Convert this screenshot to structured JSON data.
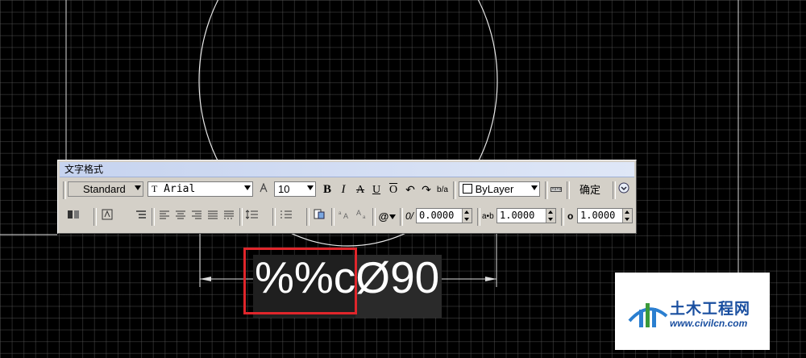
{
  "toolbar": {
    "title": "文字格式",
    "style": "Standard",
    "font_prefix": "T",
    "font": "Arial",
    "height": "10",
    "bold": "B",
    "italic": "I",
    "strike": "A",
    "underline": "U",
    "overline": "O",
    "undo": "↶",
    "redo": "↷",
    "stack": "b/a",
    "color": "ByLayer",
    "ok": "确定",
    "oblique_label": "0/",
    "oblique_value": "0.0000",
    "tracking_label": "a•b",
    "tracking_value": "1.0000",
    "width_label": "o",
    "width_value": "1.0000",
    "at_symbol": "@"
  },
  "editor": {
    "text": "%%cØ90"
  },
  "watermark": {
    "name": "土木工程网",
    "url": "www.civilcn.com"
  },
  "colors": {
    "highlight": "#e0262b",
    "toolbar_bg": "#d4d0c8",
    "brand": "#1a4fa0"
  }
}
